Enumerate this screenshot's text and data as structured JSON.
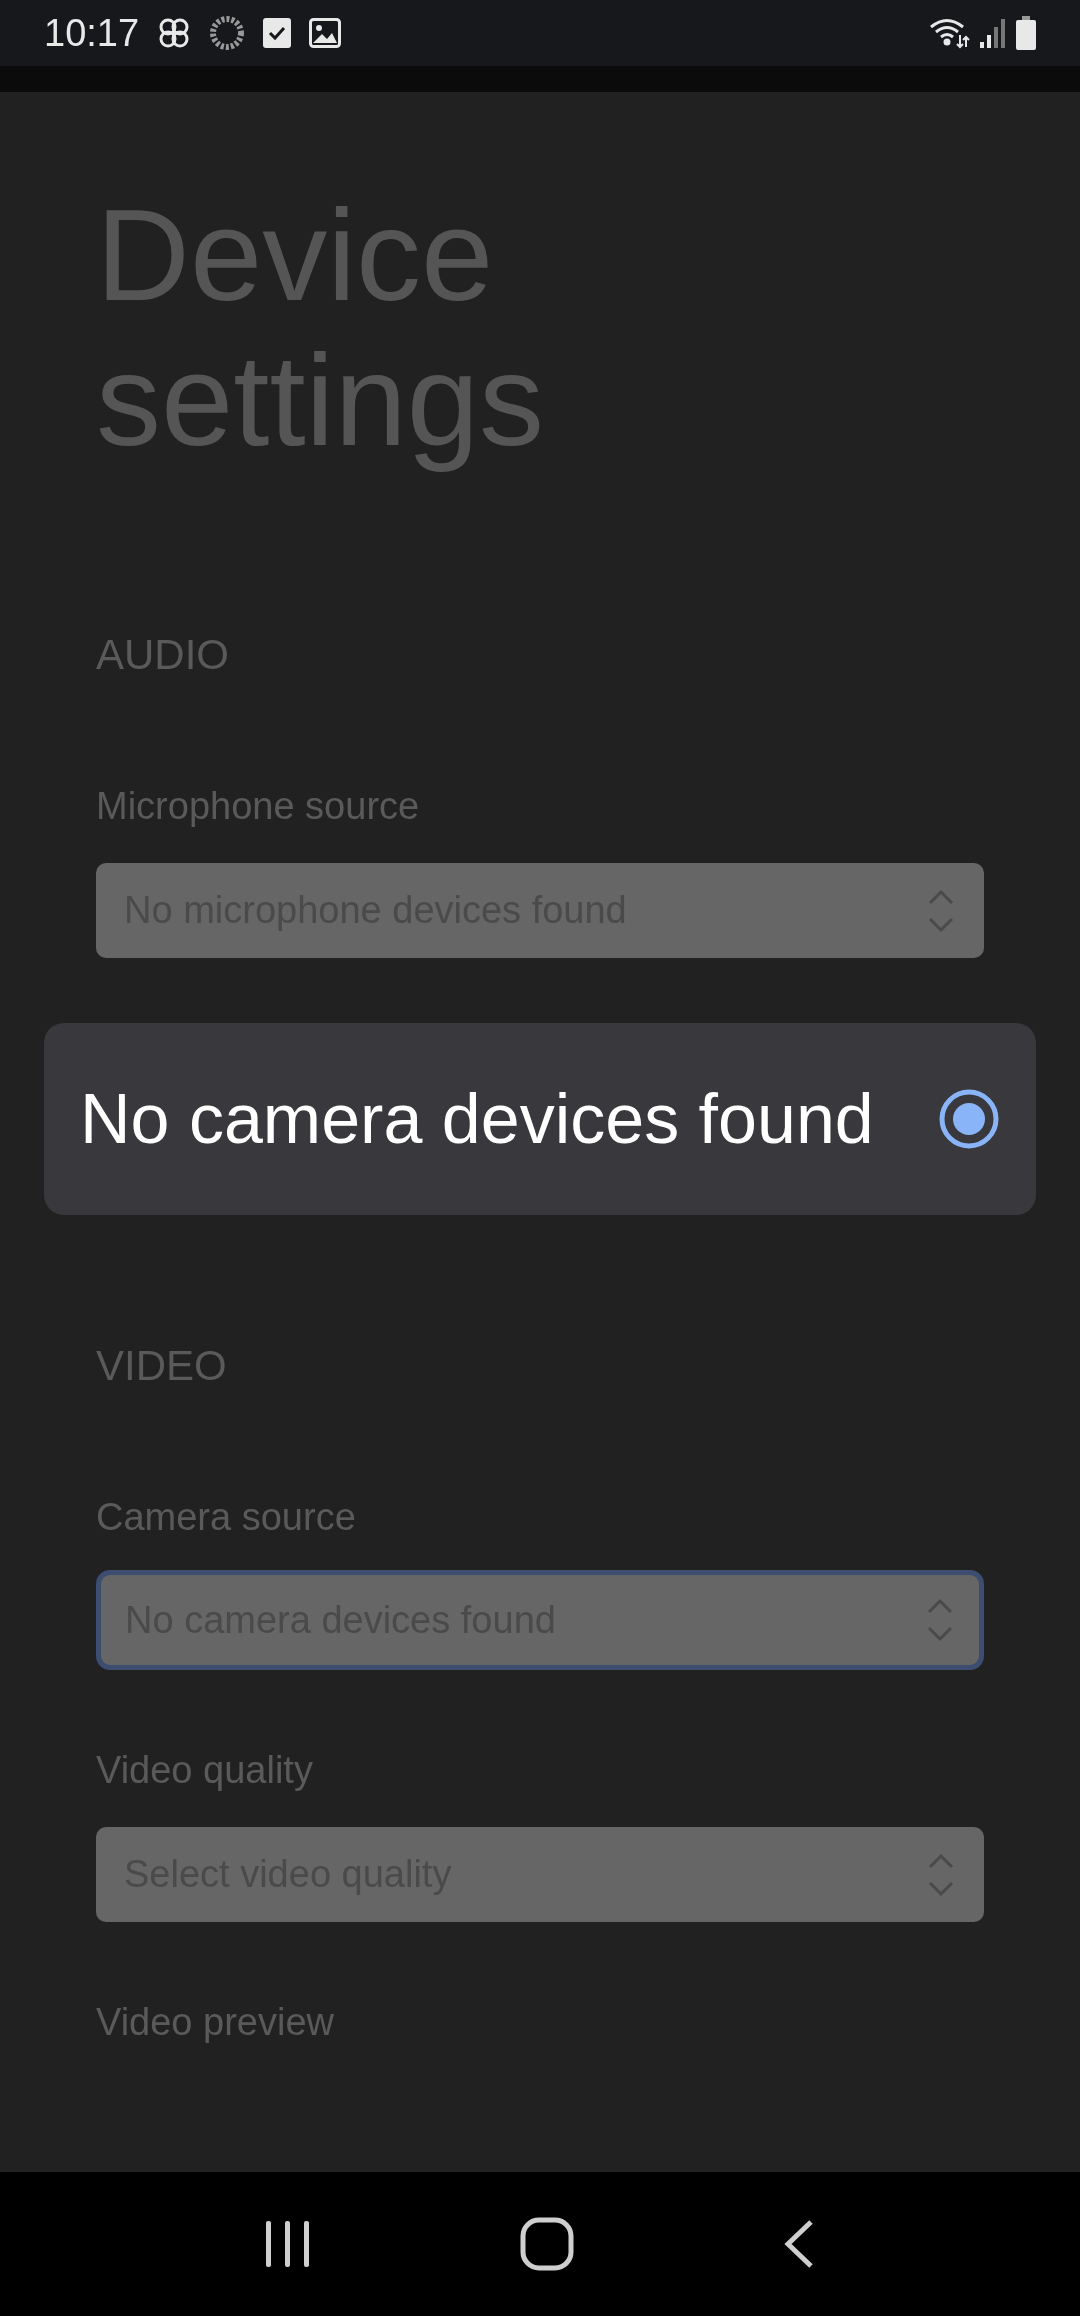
{
  "status_bar": {
    "time": "10:17"
  },
  "title": "Device settings",
  "sections": [
    {
      "heading": "AUDIO",
      "fields": [
        {
          "label": "Microphone source",
          "value": "No microphone devices found",
          "focused": false
        }
      ]
    },
    {
      "heading": "VIDEO",
      "fields": [
        {
          "label": "Camera source",
          "value": "No camera devices found",
          "focused": true
        },
        {
          "label": "Video quality",
          "placeholder": "Select video quality",
          "focused": false
        }
      ]
    }
  ],
  "trailing_label": "Video preview",
  "dialog": {
    "options": [
      {
        "label": "No camera devices found",
        "selected": true
      }
    ]
  }
}
